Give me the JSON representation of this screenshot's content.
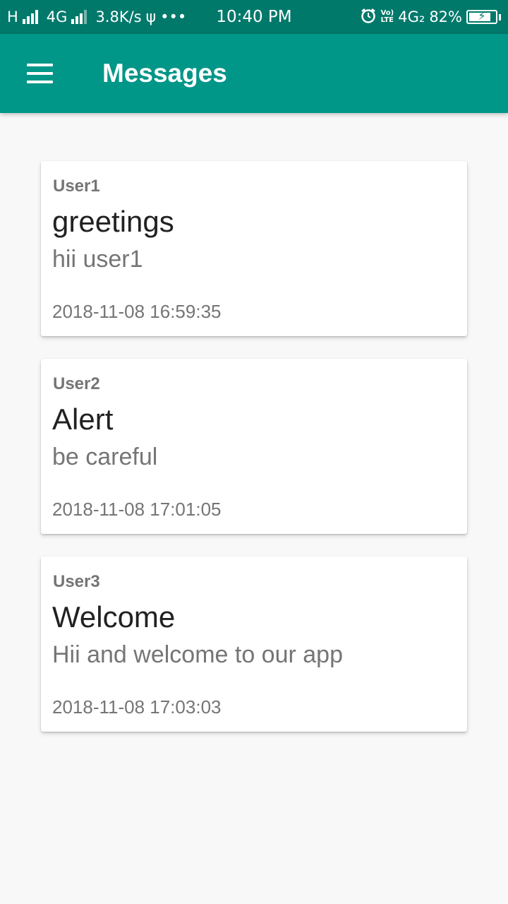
{
  "status_bar": {
    "carrier_h": "H",
    "network_4g": "4G",
    "speed": "3.8K/s",
    "usb_icon": "usb-icon",
    "more": "•••",
    "time": "10:40 PM",
    "volte_top": "Vo)",
    "volte_bottom": "LTE",
    "network_4g2": "4G₂",
    "battery_percent": "82%",
    "battery_level": 0.82
  },
  "app_bar": {
    "title": "Messages",
    "menu_icon": "hamburger-menu-icon"
  },
  "messages": [
    {
      "sender": "User1",
      "subject": "greetings",
      "body": "hii user1",
      "timestamp": "2018-11-08 16:59:35"
    },
    {
      "sender": "User2",
      "subject": "Alert",
      "body": "be careful",
      "timestamp": "2018-11-08 17:01:05"
    },
    {
      "sender": "User3",
      "subject": "Welcome",
      "body": "Hii and welcome to our app",
      "timestamp": "2018-11-08 17:03:03"
    }
  ],
  "colors": {
    "status_bar": "#00796b",
    "app_bar": "#009688",
    "background": "#f8f8f8",
    "card": "#ffffff",
    "primary_text": "#212121",
    "secondary_text": "#757575"
  }
}
